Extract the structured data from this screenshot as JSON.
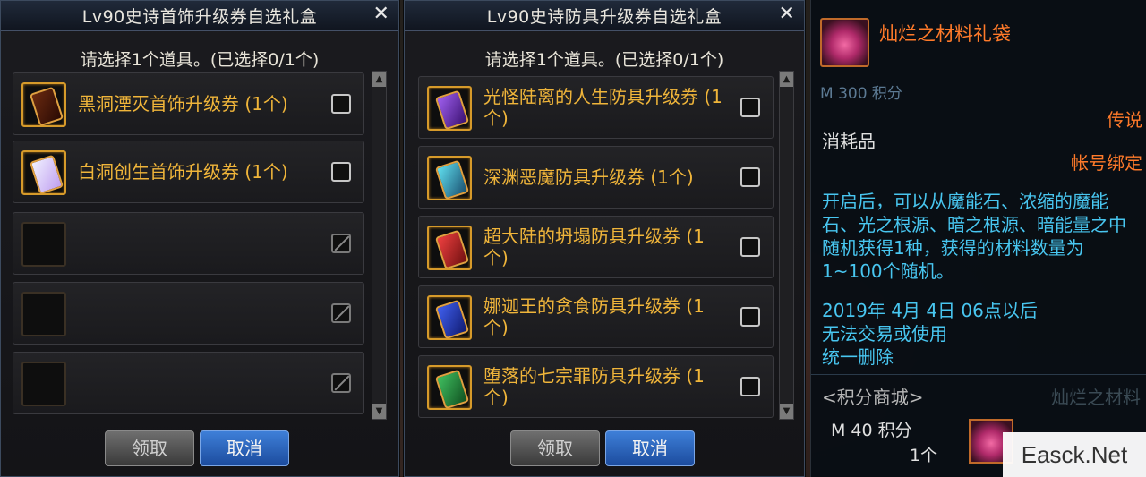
{
  "colors": {
    "item_name": "#f0b53a",
    "tooltip_title": "#ff7a2a",
    "tooltip_desc": "#48c6f0",
    "button_blue": "#2a62be",
    "button_grey": "#555555"
  },
  "windows": [
    {
      "title": "Lv90史诗首饰升级券自选礼盒",
      "prompt": "请选择1个道具。(已选择0/1个)",
      "slots": [
        {
          "name": "黑洞湮灭首饰升级券 (1个)",
          "icon": "scroll-dark-icon",
          "checkbox": "unchecked"
        },
        {
          "name": "白洞创生首饰升级券 (1个)",
          "icon": "scroll-white-icon",
          "checkbox": "unchecked"
        },
        {
          "name": "",
          "icon": "empty-slot",
          "checkbox": "disabled"
        },
        {
          "name": "",
          "icon": "empty-slot",
          "checkbox": "disabled"
        },
        {
          "name": "",
          "icon": "empty-slot",
          "checkbox": "disabled"
        }
      ],
      "buttons": {
        "confirm": "领取",
        "cancel": "取消"
      }
    },
    {
      "title": "Lv90史诗防具升级券自选礼盒",
      "prompt": "请选择1个道具。(已选择0/1个)",
      "slots": [
        {
          "name": "光怪陆离的人生防具升级券 (1个)",
          "icon": "scroll-purple-icon",
          "checkbox": "unchecked"
        },
        {
          "name": "深渊恶魔防具升级券 (1个)",
          "icon": "scroll-cyan-icon",
          "checkbox": "unchecked"
        },
        {
          "name": "超大陆的坍塌防具升级券 (1个)",
          "icon": "scroll-red-icon",
          "checkbox": "unchecked"
        },
        {
          "name": "娜迦王的贪食防具升级券 (1个)",
          "icon": "scroll-blue-icon",
          "checkbox": "unchecked"
        },
        {
          "name": "堕落的七宗罪防具升级券 (1个)",
          "icon": "scroll-green-icon",
          "checkbox": "unchecked"
        }
      ],
      "buttons": {
        "confirm": "领取",
        "cancel": "取消"
      }
    }
  ],
  "tooltip": {
    "title": "灿烂之材料礼袋",
    "points_label": "M 300 积分",
    "rarity": "传说",
    "type": "消耗品",
    "bind": "帐号绑定",
    "description": "开启后，可以从魔能石、浓缩的魔能石、光之根源、暗之根源、暗能量之中随机获得1种，获得的材料数量为1~100个随机。",
    "date_line": "2019年 4月 4日 06点以后",
    "restriction_1": "无法交易或使用",
    "restriction_2": "统一删除",
    "shop": "<积分商城>",
    "shop_item": "灿烂之材料",
    "m40": "M 40 积分",
    "qty": "1个"
  },
  "watermark": "Easck.Net"
}
